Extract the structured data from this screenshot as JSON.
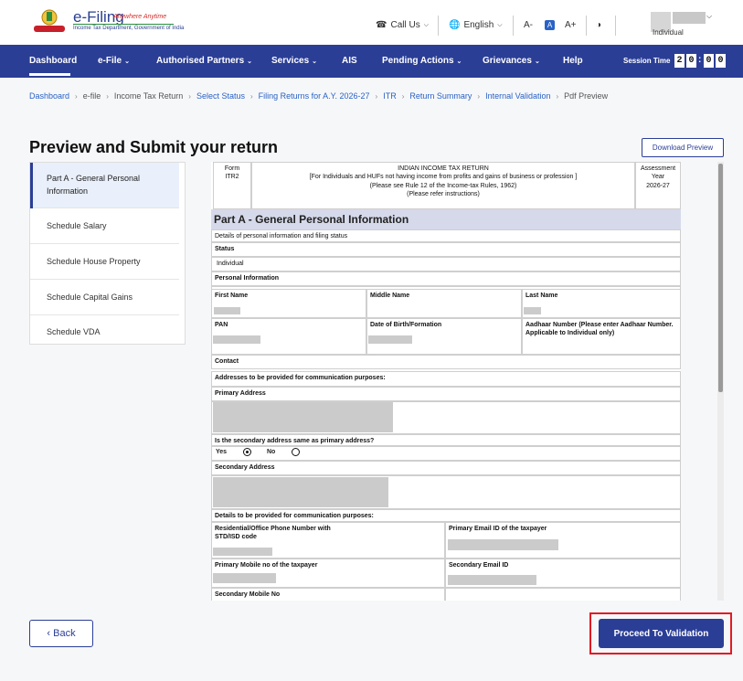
{
  "header": {
    "logo_title": "e-Filing",
    "logo_tagline": "Anywhere Anytime",
    "logo_sub": "Income Tax Department, Government of India",
    "call_us": "Call Us",
    "language": "English",
    "font_decrease": "A-",
    "font_default": "A",
    "font_increase": "A+",
    "user_role": "Individual"
  },
  "nav": {
    "items": [
      "Dashboard",
      "e-File",
      "Authorised Partners",
      "Services",
      "AIS",
      "Pending Actions",
      "Grievances",
      "Help"
    ],
    "session_label": "Session Time",
    "session_digits": [
      "2",
      "0",
      "0",
      "0"
    ]
  },
  "breadcrumb": [
    "Dashboard",
    "e-file",
    "Income Tax Return",
    "Select Status",
    "Filing Returns for A.Y. 2026-27",
    "ITR",
    "Return Summary",
    "Internal Validation",
    "Pdf Preview"
  ],
  "page": {
    "title": "Preview and Submit your return",
    "download_label": "Download Preview"
  },
  "sidebar": {
    "items": [
      "Part A - General Personal Information",
      "Schedule Salary",
      "Schedule House Property",
      "Schedule Capital Gains",
      "Schedule VDA"
    ]
  },
  "document": {
    "form_label": "Form",
    "form_value": "ITR2",
    "head_title": "INDIAN INCOME TAX RETURN",
    "head_line2": "[For Individuals and HUFs not having income from profits and gains of business or profession ]",
    "head_line3": "(Please see Rule 12 of the Income-tax Rules, 1962)",
    "head_line4": "(Please refer instructions)",
    "ay_label": "Assessment Year",
    "ay_value": "2026-27",
    "parta_title": "Part A - General Personal Information",
    "details_caption": "Details of personal information and filing status",
    "status_label": "Status",
    "status_value": "Individual",
    "personal_info": "Personal Information",
    "first_name": "First Name",
    "middle_name": "Middle Name",
    "last_name": "Last Name",
    "pan": "PAN",
    "dob": "Date of Birth/Formation",
    "aadhaar": "Aadhaar Number (Please enter Aadhaar Number. Applicable to Individual only)",
    "contact": "Contact",
    "addresses_caption": "Addresses to be provided for communication purposes:",
    "primary_address": "Primary Address",
    "secondary_same_q": "Is the secondary address same as primary address?",
    "yes": "Yes",
    "no": "No",
    "secondary_address": "Secondary Address",
    "details_comm": "Details to be provided for communication purposes:",
    "phone_label": "Residential/Office Phone Number with STD/ISD code",
    "primary_email": "Primary Email ID of the taxpayer",
    "primary_mobile": "Primary Mobile no of the taxpayer",
    "secondary_email": "Secondary Email ID",
    "secondary_mobile": "Secondary Mobile No"
  },
  "footer": {
    "back_label": "Back",
    "proceed_label": "Proceed To Validation"
  }
}
